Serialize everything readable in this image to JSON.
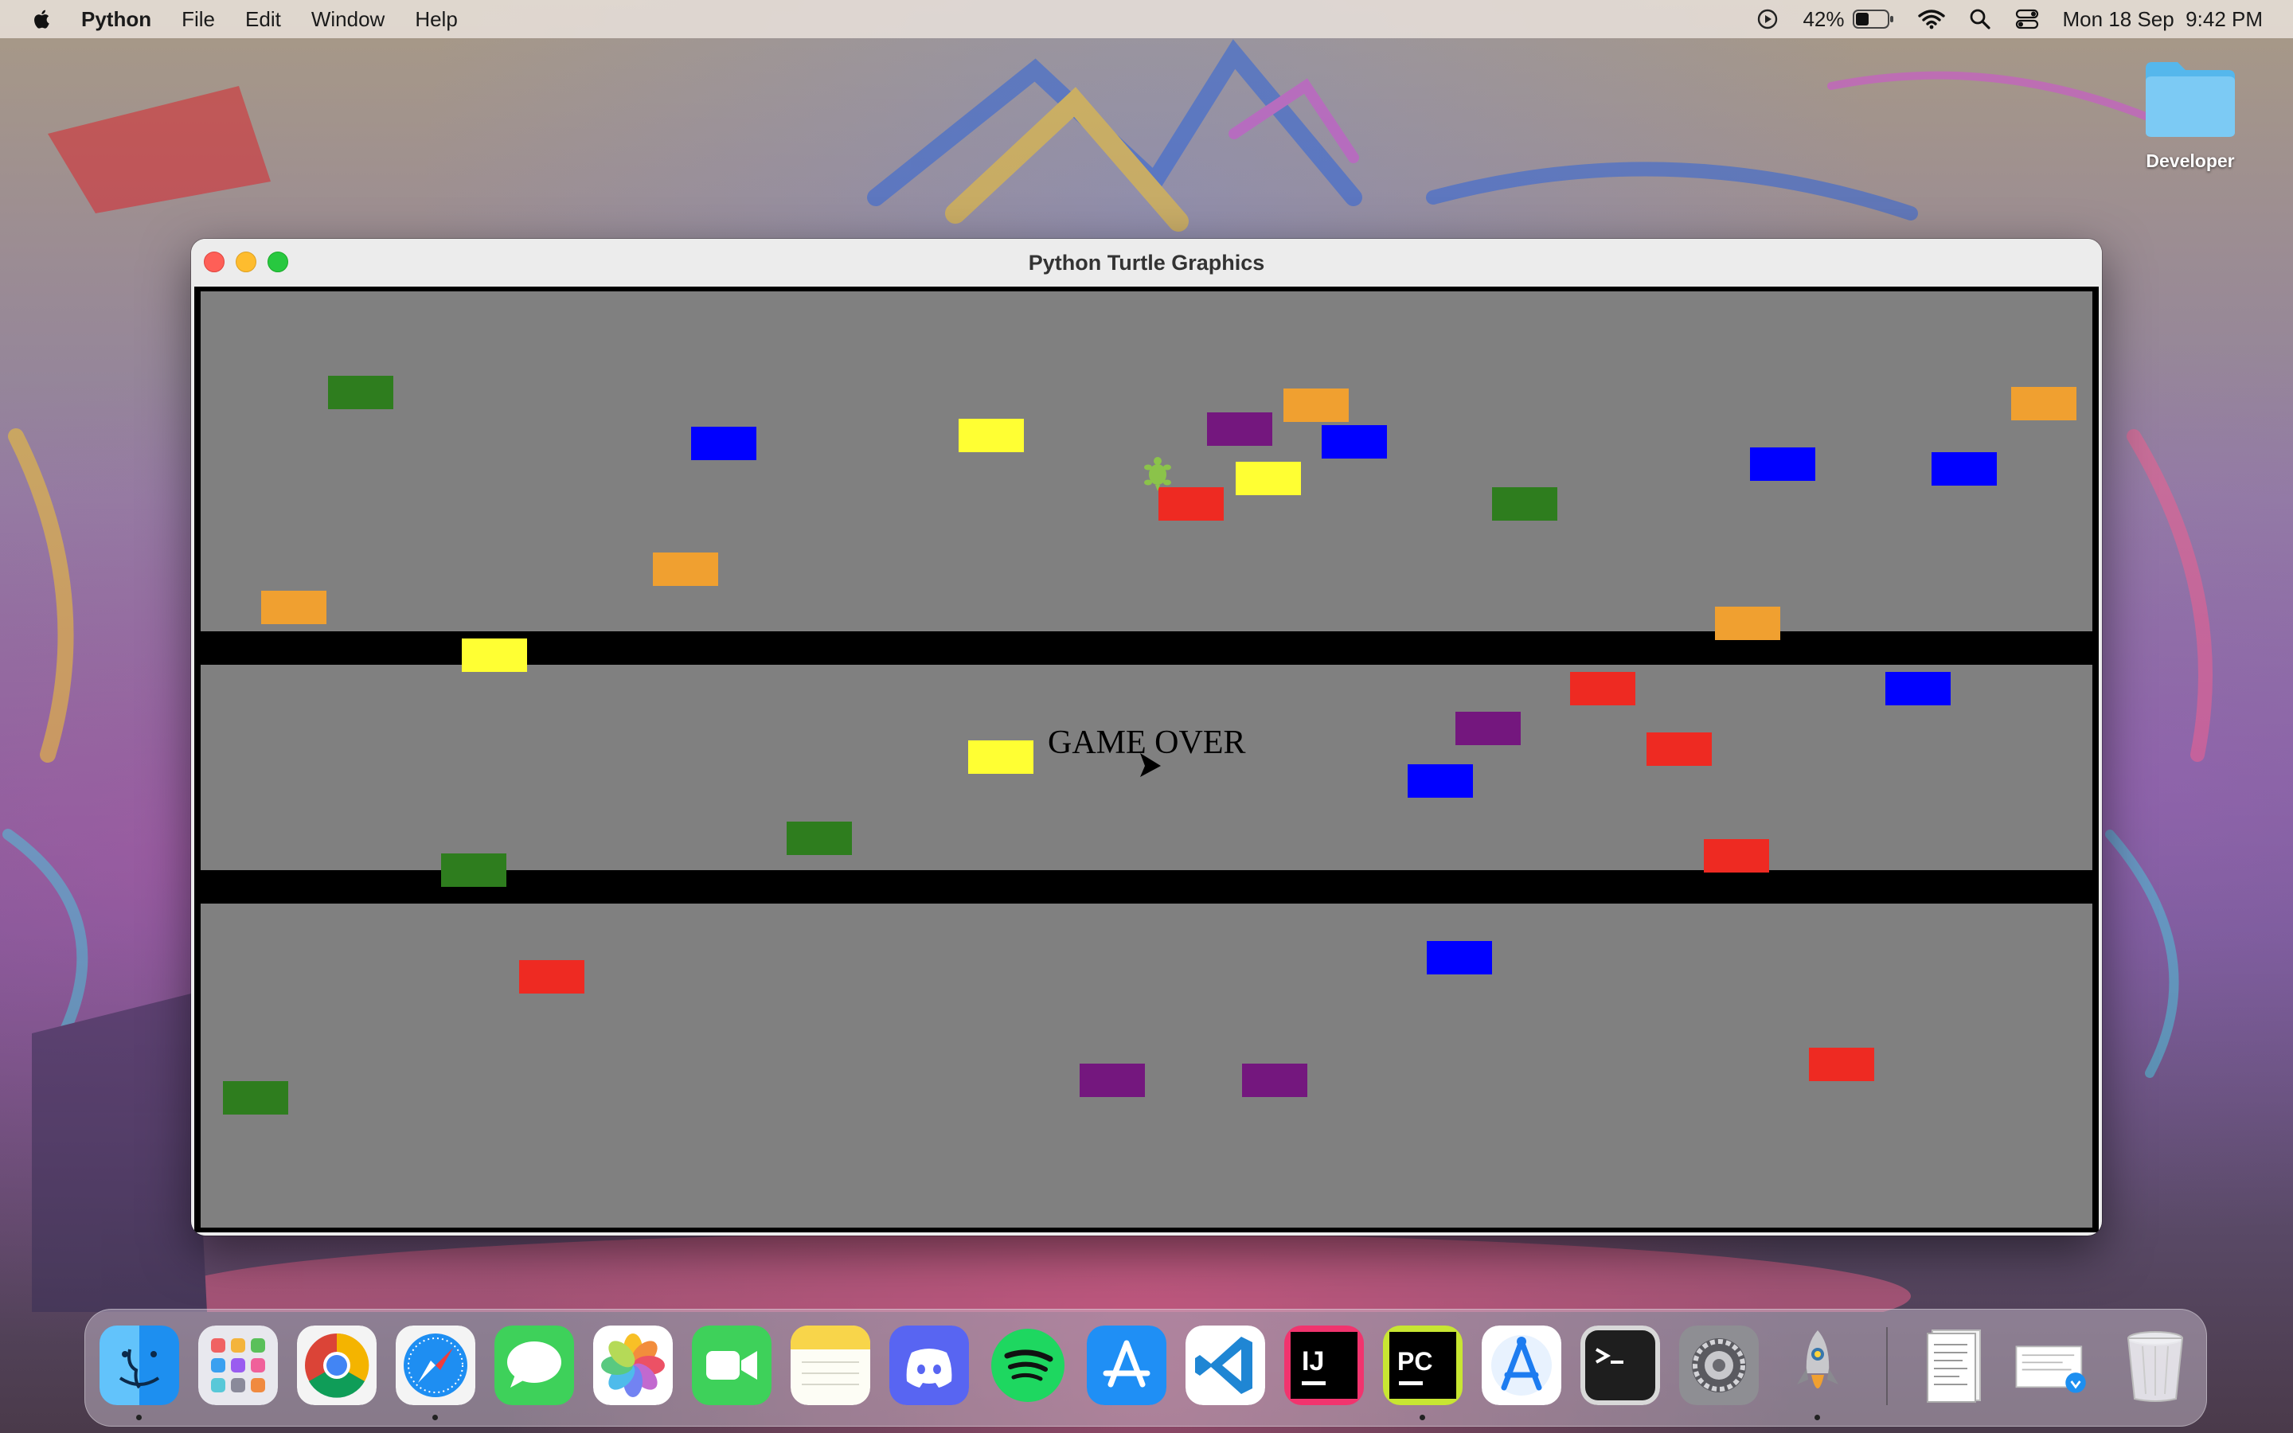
{
  "menubar": {
    "app_name": "Python",
    "items": [
      "File",
      "Edit",
      "Window",
      "Help"
    ],
    "battery_percent": "42%",
    "battery_level": 0.42,
    "datetime": "Mon 18 Sep  9:42 PM",
    "status_icons": [
      "play-circle-icon",
      "battery-icon",
      "wifi-icon",
      "spotlight-search-icon",
      "control-center-icon"
    ]
  },
  "desktop": {
    "folder_label": "Developer"
  },
  "window": {
    "title": "Python Turtle Graphics",
    "canvas_background": "#808080",
    "game_over_text": "GAME OVER",
    "block_colors": {
      "green": "#2e7d1e",
      "blue": "#0000ff",
      "yellow": "#ffff33",
      "orange": "#f0a030",
      "purple": "#74177e",
      "red": "#ee2a22",
      "black": "#000000",
      "turtle": "#8bc34a"
    }
  },
  "dock": {
    "apps": [
      {
        "name": "Finder",
        "icon": "finder-icon",
        "running": true
      },
      {
        "name": "Launchpad",
        "icon": "launchpad-icon",
        "running": false
      },
      {
        "name": "Google Chrome",
        "icon": "chrome-icon",
        "running": false
      },
      {
        "name": "Safari",
        "icon": "safari-icon",
        "running": true
      },
      {
        "name": "Messages",
        "icon": "messages-icon",
        "running": false
      },
      {
        "name": "Photos",
        "icon": "photos-icon",
        "running": false
      },
      {
        "name": "FaceTime",
        "icon": "facetime-icon",
        "running": false
      },
      {
        "name": "Notes",
        "icon": "notes-icon",
        "running": false
      },
      {
        "name": "Discord",
        "icon": "discord-icon",
        "running": false
      },
      {
        "name": "Spotify",
        "icon": "spotify-icon",
        "running": false
      },
      {
        "name": "App Store",
        "icon": "app-store-icon",
        "running": false
      },
      {
        "name": "Visual Studio Code",
        "icon": "vscode-icon",
        "running": false
      },
      {
        "name": "IntelliJ IDEA",
        "icon": "intellij-icon",
        "running": false
      },
      {
        "name": "PyCharm",
        "icon": "pycharm-icon",
        "running": true
      },
      {
        "name": "Instruments",
        "icon": "instruments-icon",
        "running": false
      },
      {
        "name": "Terminal",
        "icon": "terminal-icon",
        "running": false
      },
      {
        "name": "System Settings",
        "icon": "system-settings-icon",
        "running": false
      },
      {
        "name": "Python Launcher",
        "icon": "python-rocket-icon",
        "running": true
      }
    ],
    "recent": [
      {
        "name": "Document",
        "icon": "document-stack-icon"
      },
      {
        "name": "Downloads",
        "icon": "downloads-stack-icon"
      },
      {
        "name": "Trash",
        "icon": "trash-icon"
      }
    ]
  }
}
